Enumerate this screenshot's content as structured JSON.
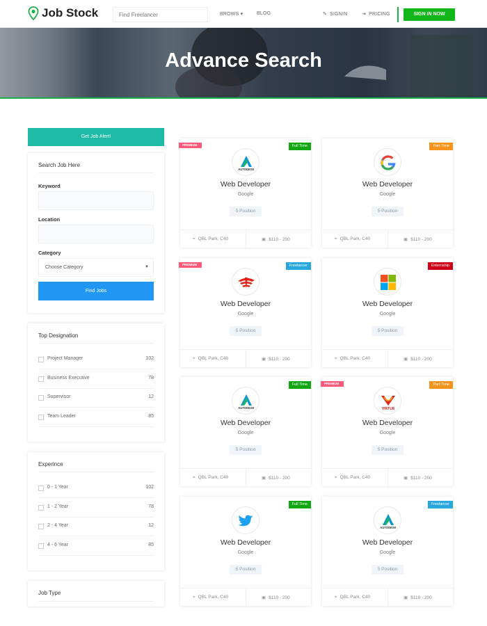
{
  "nav": {
    "logo_text": "Job Stock",
    "search_placeholder": "Find Freelancer",
    "browse": "BROWS ▾",
    "blog": "BLOG",
    "signin": "SIGNIN",
    "pricing": "PRICING",
    "signup": "SIGN IN NOW"
  },
  "hero": {
    "title": "Advance Search"
  },
  "sidebar": {
    "alert_button": "Get Job Alert!",
    "search": {
      "title": "Search Job Here",
      "keyword_label": "Keyword",
      "keyword_value": "",
      "location_label": "Location",
      "location_value": "",
      "category_label": "Category",
      "category_value": "Choose Category",
      "find_button": "Find Jobs"
    },
    "designation": {
      "title": "Top Designation",
      "items": [
        {
          "label": "Project Manager",
          "count": "102"
        },
        {
          "label": "Business Executive",
          "count": "78"
        },
        {
          "label": "Supervisor",
          "count": "12"
        },
        {
          "label": "Team Leader",
          "count": "85"
        }
      ]
    },
    "experience": {
      "title": "Experince",
      "items": [
        {
          "label": "0 - 1 Year",
          "count": "102"
        },
        {
          "label": "1 - 2 Year",
          "count": "78"
        },
        {
          "label": "2 - 4 Year",
          "count": "12"
        },
        {
          "label": "4 - 6 Year",
          "count": "85"
        }
      ]
    },
    "job_type": {
      "title": "Job Type"
    }
  },
  "jobs": [
    {
      "premium": "PREMIUM",
      "type": "Full Time",
      "type_color": "#11a711",
      "logo": "autodesk-logo",
      "title": "Web Developer",
      "company": "Google",
      "positions": "5 Position",
      "location": "QBL Park, C40",
      "salary": "$110 - 200"
    },
    {
      "premium": "",
      "type": "Part Time",
      "type_color": "#f7941d",
      "logo": "google-logo",
      "title": "Web Developer",
      "company": "Google",
      "positions": "5 Position",
      "location": "QBL Park, C40",
      "salary": "$110 - 200"
    },
    {
      "premium": "PREMIUM",
      "type": "Freelancer",
      "type_color": "#29a8e0",
      "logo": "honda-logo",
      "title": "Web Developer",
      "company": "Google",
      "positions": "5 Position",
      "location": "QBL Park, C40",
      "salary": "$110 - 200"
    },
    {
      "premium": "",
      "type": "Enternship",
      "type_color": "#d0021b",
      "logo": "microsoft-logo",
      "title": "Web Developer",
      "company": "Google",
      "positions": "5 Position",
      "location": "QBL Park, C40",
      "salary": "$110 - 200"
    },
    {
      "premium": "",
      "type": "Full Time",
      "type_color": "#11a711",
      "logo": "autodesk-logo",
      "title": "Web Developer",
      "company": "Google",
      "positions": "5 Position",
      "location": "QBL Park, C40",
      "salary": "$110 - 200"
    },
    {
      "premium": "PREMIUM",
      "type": "Part Time",
      "type_color": "#f7941d",
      "logo": "virtue-logo",
      "title": "Web Developer",
      "company": "Google",
      "positions": "5 Position",
      "location": "QBL Park, C40",
      "salary": "$110 - 200"
    },
    {
      "premium": "",
      "type": "Full Time",
      "type_color": "#11a711",
      "logo": "twitter-logo",
      "title": "Web Developer",
      "company": "Google",
      "positions": "5 Position",
      "location": "QBL Park, C40",
      "salary": "$110 - 200"
    },
    {
      "premium": "",
      "type": "Freelancer",
      "type_color": "#29a8e0",
      "logo": "autodesk-logo",
      "title": "Web Developer",
      "company": "Google",
      "positions": "5 Position",
      "location": "QBL Park, C40",
      "salary": "$110 - 200"
    }
  ],
  "logo_texts": {
    "autodesk": "AUTODESK",
    "virtue": "VIRTUE"
  }
}
